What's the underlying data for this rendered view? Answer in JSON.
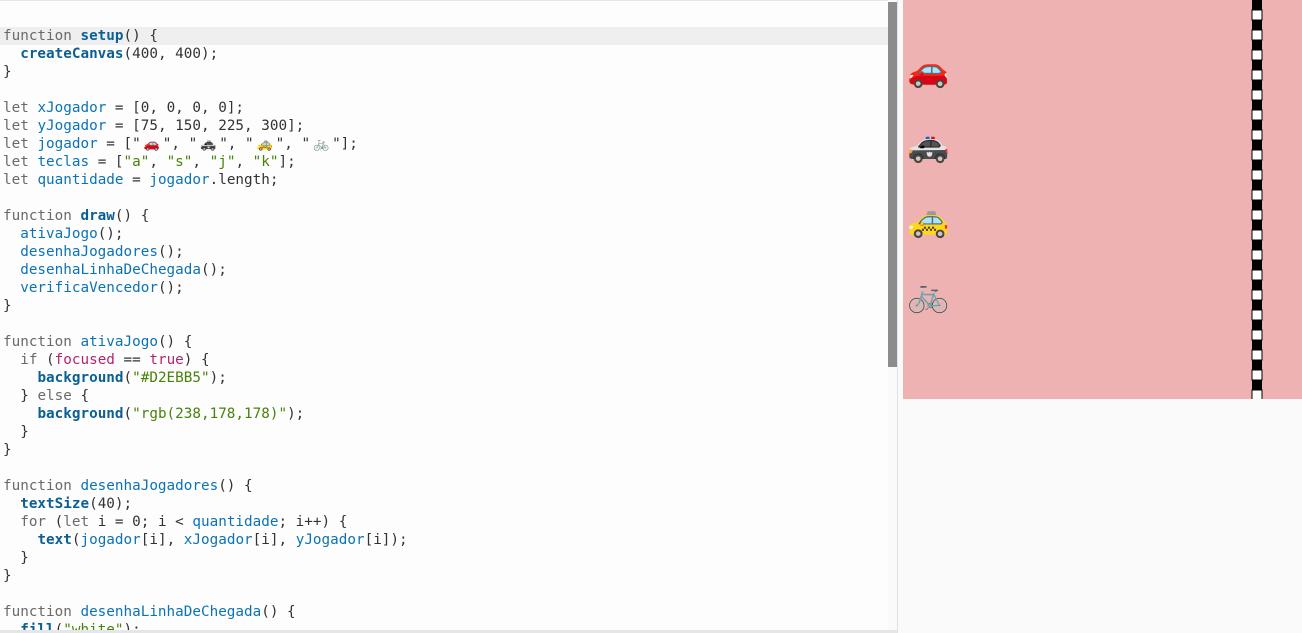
{
  "editor": {
    "lines": [
      [
        [
          "kw",
          "function "
        ],
        [
          "bfn",
          "setup"
        ],
        [
          "punc",
          "() {"
        ]
      ],
      [
        [
          "punc",
          "  "
        ],
        [
          "bfn",
          "createCanvas"
        ],
        [
          "punc",
          "(400, 400);"
        ]
      ],
      [
        [
          "punc",
          "}"
        ]
      ],
      [
        [
          "punc",
          ""
        ]
      ],
      [
        [
          "kw",
          "let "
        ],
        [
          "fn",
          "xJogador"
        ],
        [
          "punc",
          " = [0, 0, 0, 0];"
        ]
      ],
      [
        [
          "kw",
          "let "
        ],
        [
          "fn",
          "yJogador"
        ],
        [
          "punc",
          " = [75, 150, 225, 300];"
        ]
      ],
      [
        [
          "kw",
          "let "
        ],
        [
          "fn",
          "jogador"
        ],
        [
          "punc",
          " = [\""
        ],
        [
          "emoji",
          "🚗"
        ],
        [
          "punc",
          "\", \""
        ],
        [
          "emoji",
          "🚓"
        ],
        [
          "punc",
          "\", \""
        ],
        [
          "emoji",
          "🚕"
        ],
        [
          "punc",
          "\", \""
        ],
        [
          "emoji",
          "🚲"
        ],
        [
          "punc",
          "\"];"
        ]
      ],
      [
        [
          "kw",
          "let "
        ],
        [
          "fn",
          "teclas"
        ],
        [
          "punc",
          " = ["
        ],
        [
          "str",
          "\"a\""
        ],
        [
          "punc",
          ", "
        ],
        [
          "str",
          "\"s\""
        ],
        [
          "punc",
          ", "
        ],
        [
          "str",
          "\"j\""
        ],
        [
          "punc",
          ", "
        ],
        [
          "str",
          "\"k\""
        ],
        [
          "punc",
          "];"
        ]
      ],
      [
        [
          "kw",
          "let "
        ],
        [
          "fn",
          "quantidade"
        ],
        [
          "punc",
          " = "
        ],
        [
          "fn",
          "jogador"
        ],
        [
          "punc",
          ".length;"
        ]
      ],
      [
        [
          "punc",
          ""
        ]
      ],
      [
        [
          "kw",
          "function "
        ],
        [
          "bfn",
          "draw"
        ],
        [
          "punc",
          "() {"
        ]
      ],
      [
        [
          "punc",
          "  "
        ],
        [
          "fn",
          "ativaJogo"
        ],
        [
          "punc",
          "();"
        ]
      ],
      [
        [
          "punc",
          "  "
        ],
        [
          "fn",
          "desenhaJogadores"
        ],
        [
          "punc",
          "();"
        ]
      ],
      [
        [
          "punc",
          "  "
        ],
        [
          "fn",
          "desenhaLinhaDeChegada"
        ],
        [
          "punc",
          "();"
        ]
      ],
      [
        [
          "punc",
          "  "
        ],
        [
          "fn",
          "verificaVencedor"
        ],
        [
          "punc",
          "();"
        ]
      ],
      [
        [
          "punc",
          "}"
        ]
      ],
      [
        [
          "punc",
          ""
        ]
      ],
      [
        [
          "kw",
          "function "
        ],
        [
          "fn",
          "ativaJogo"
        ],
        [
          "punc",
          "() {"
        ]
      ],
      [
        [
          "punc",
          "  "
        ],
        [
          "kw",
          "if"
        ],
        [
          "punc",
          " ("
        ],
        [
          "lit",
          "focused"
        ],
        [
          "punc",
          " == "
        ],
        [
          "lit",
          "true"
        ],
        [
          "punc",
          ") {"
        ]
      ],
      [
        [
          "punc",
          "    "
        ],
        [
          "bfn",
          "background"
        ],
        [
          "punc",
          "("
        ],
        [
          "str",
          "\"#D2EBB5\""
        ],
        [
          "punc",
          ");"
        ]
      ],
      [
        [
          "punc",
          "  } "
        ],
        [
          "kw",
          "else"
        ],
        [
          "punc",
          " {"
        ]
      ],
      [
        [
          "punc",
          "    "
        ],
        [
          "bfn",
          "background"
        ],
        [
          "punc",
          "("
        ],
        [
          "str",
          "\"rgb(238,178,178)\""
        ],
        [
          "punc",
          ");"
        ]
      ],
      [
        [
          "punc",
          "  }"
        ]
      ],
      [
        [
          "punc",
          "}"
        ]
      ],
      [
        [
          "punc",
          ""
        ]
      ],
      [
        [
          "kw",
          "function "
        ],
        [
          "fn",
          "desenhaJogadores"
        ],
        [
          "punc",
          "() {"
        ]
      ],
      [
        [
          "punc",
          "  "
        ],
        [
          "bfn",
          "textSize"
        ],
        [
          "punc",
          "(40);"
        ]
      ],
      [
        [
          "punc",
          "  "
        ],
        [
          "kw",
          "for"
        ],
        [
          "punc",
          " ("
        ],
        [
          "kw",
          "let"
        ],
        [
          "punc",
          " i = 0; i < "
        ],
        [
          "fn",
          "quantidade"
        ],
        [
          "punc",
          "; i++) {"
        ]
      ],
      [
        [
          "punc",
          "    "
        ],
        [
          "bfn",
          "text"
        ],
        [
          "punc",
          "("
        ],
        [
          "fn",
          "jogador"
        ],
        [
          "punc",
          "[i], "
        ],
        [
          "fn",
          "xJogador"
        ],
        [
          "punc",
          "[i], "
        ],
        [
          "fn",
          "yJogador"
        ],
        [
          "punc",
          "[i]);"
        ]
      ],
      [
        [
          "punc",
          "  }"
        ]
      ],
      [
        [
          "punc",
          "}"
        ]
      ],
      [
        [
          "punc",
          ""
        ]
      ],
      [
        [
          "kw",
          "function "
        ],
        [
          "fn",
          "desenhaLinhaDeChegada"
        ],
        [
          "punc",
          "() {"
        ]
      ],
      [
        [
          "punc",
          "  "
        ],
        [
          "bfn",
          "fill"
        ],
        [
          "punc",
          "("
        ],
        [
          "str",
          "\"white\""
        ],
        [
          "punc",
          ");"
        ]
      ]
    ]
  },
  "preview": {
    "background": "rgb(238,178,178)",
    "players": [
      "🚗",
      "🚓",
      "🚕",
      "🚲"
    ],
    "finish_line_colors": [
      "#000000",
      "#ffffff"
    ]
  }
}
